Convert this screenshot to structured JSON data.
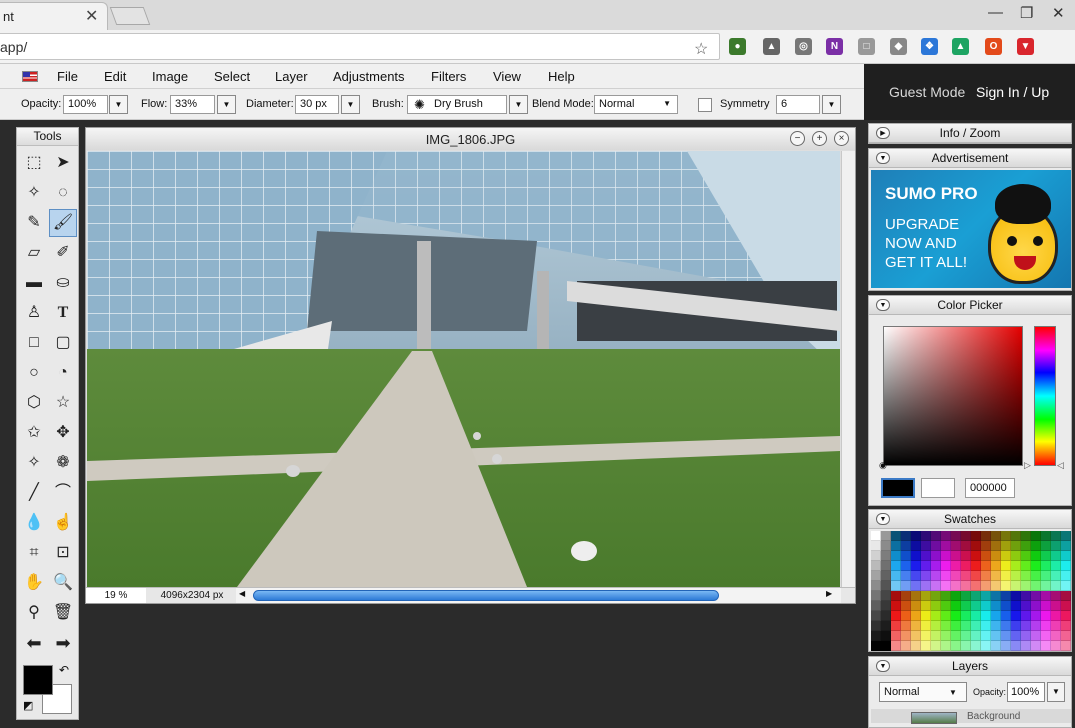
{
  "browser": {
    "tab_title": "nt",
    "url": "app/",
    "extensions": [
      {
        "name": "globe-icon",
        "color": "#3c7a2c",
        "glyph": "●"
      },
      {
        "name": "tree-icon",
        "color": "#666666",
        "glyph": "▲"
      },
      {
        "name": "stopwatch-icon",
        "color": "#777777",
        "glyph": "◎"
      },
      {
        "name": "onenote-icon",
        "color": "#7b2fa6",
        "glyph": "N"
      },
      {
        "name": "page-icon",
        "color": "#999999",
        "glyph": "□"
      },
      {
        "name": "shield-icon",
        "color": "#888888",
        "glyph": "◆"
      },
      {
        "name": "dropbox-icon",
        "color": "#2c77d8",
        "glyph": "❖"
      },
      {
        "name": "drive-icon",
        "color": "#1da462",
        "glyph": "▲"
      },
      {
        "name": "office-icon",
        "color": "#e34a1a",
        "glyph": "O"
      },
      {
        "name": "pocket-icon",
        "color": "#d9262d",
        "glyph": "▼"
      }
    ]
  },
  "menu": {
    "items": [
      "File",
      "Edit",
      "Image",
      "Select",
      "Layer",
      "Adjustments",
      "Filters",
      "View",
      "Help"
    ]
  },
  "options": {
    "opacity_label": "Opacity:",
    "opacity_value": "100%",
    "flow_label": "Flow:",
    "flow_value": "33%",
    "diameter_label": "Diameter:",
    "diameter_value": "30 px",
    "brush_label": "Brush:",
    "brush_value": "Dry Brush",
    "blend_label": "Blend Mode:",
    "blend_value": "Normal",
    "symmetry_label": "Symmetry",
    "symmetry_value": "6"
  },
  "user": {
    "guest": "Guest Mode",
    "signin": "Sign In / Up"
  },
  "tools": {
    "title": "Tools",
    "letter_tool": "T"
  },
  "image_window": {
    "title": "IMG_1806.JPG",
    "zoom": "19 %",
    "dimensions": "4096x2304 px"
  },
  "panels": {
    "info": "Info / Zoom",
    "advertisement": "Advertisement",
    "color_picker": "Color Picker",
    "swatches": "Swatches",
    "layers": "Layers"
  },
  "ad": {
    "title": "SUMO PRO",
    "line1": "UPGRADE",
    "line2": "NOW AND",
    "line3": "GET IT ALL!"
  },
  "color_picker": {
    "hex": "000000",
    "primary": "#000000",
    "secondary": "#ffffff"
  },
  "layers": {
    "blend": "Normal",
    "opacity_label": "Opacity:",
    "opacity_value": "100%",
    "layer_name": "Background"
  }
}
